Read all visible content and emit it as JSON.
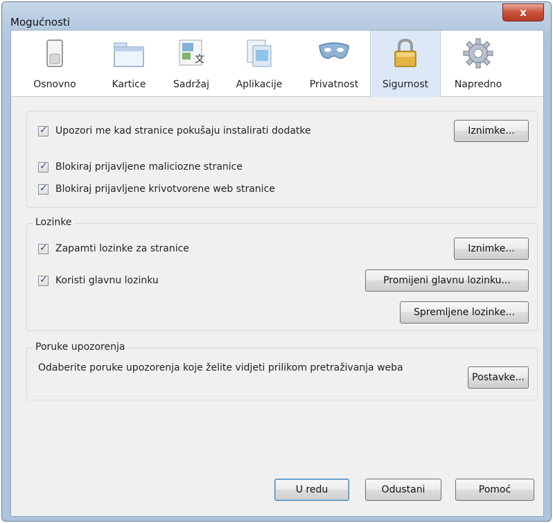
{
  "window": {
    "title": "Mogućnosti",
    "close_glyph": "x"
  },
  "toolbar": {
    "items": [
      {
        "label": "Osnovno",
        "icon": "switch-icon"
      },
      {
        "label": "Kartice",
        "icon": "tabs-icon"
      },
      {
        "label": "Sadržaj",
        "icon": "content-icon"
      },
      {
        "label": "Aplikacije",
        "icon": "applications-icon"
      },
      {
        "label": "Privatnost",
        "icon": "mask-icon"
      },
      {
        "label": "Sigurnost",
        "icon": "padlock-icon",
        "selected": true
      },
      {
        "label": "Napredno",
        "icon": "gear-icon"
      }
    ]
  },
  "general": {
    "warn_addons": "Upozori me kad stranice pokušaju instalirati dodatke",
    "exceptions_button": "Iznimke...",
    "block_malware": "Blokiraj prijavljene maliciozne stranice",
    "block_forgeries": "Blokiraj prijavljene krivotvorene web stranice"
  },
  "passwords": {
    "legend": "Lozinke",
    "remember": "Zapamti lozinke za stranice",
    "exceptions_button": "Iznimke...",
    "use_master": "Koristi glavnu lozinku",
    "change_master_button": "Promijeni glavnu lozinku...",
    "saved_button": "Spremljene lozinke..."
  },
  "warnings": {
    "legend": "Poruke upozorenja",
    "description": "Odaberite poruke upozorenja koje želite vidjeti prilikom pretraživanja weba",
    "settings_button": "Postavke..."
  },
  "footer": {
    "ok": "U redu",
    "cancel": "Odustani",
    "help": "Pomoć"
  },
  "colors": {
    "titlebar": "#b9cce3",
    "close": "#c9503a",
    "selected_tab": "#dce8f7",
    "check": "#2d4a86"
  }
}
